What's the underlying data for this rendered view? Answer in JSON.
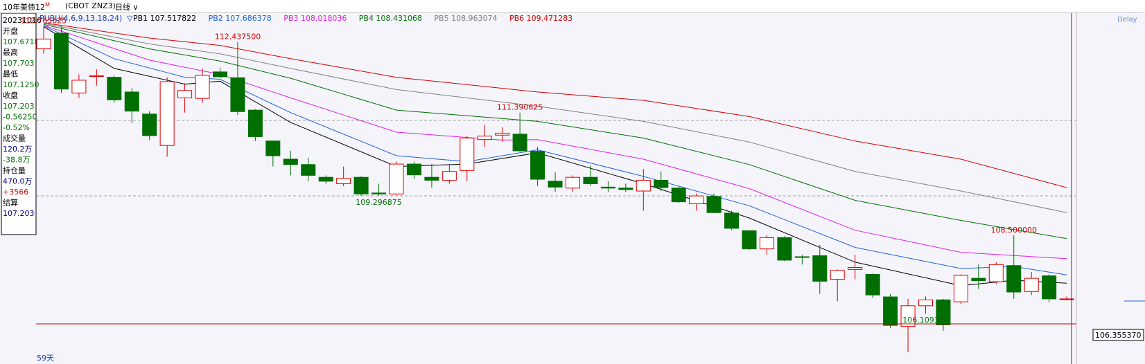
{
  "topbar": {
    "symbol_label": "10年美债12",
    "superscript": "M",
    "code": "(CBOT ZNZ3)",
    "period": "日线",
    "period_arrow": "∨"
  },
  "indicator": {
    "name": "PUBU(4,6,9,13,18,24)",
    "arrow": "▽",
    "items": [
      {
        "label": "PB1",
        "value": "107.517822",
        "color": "#000000"
      },
      {
        "label": "PB2",
        "value": "107.686378",
        "color": "#1f5fd6"
      },
      {
        "label": "PB3",
        "value": "108.018036",
        "color": "#e020e0"
      },
      {
        "label": "PB4",
        "value": "108.431068",
        "color": "#007000"
      },
      {
        "label": "PB5",
        "value": "108.963074",
        "color": "#808080"
      },
      {
        "label": "PB6",
        "value": "109.471283",
        "color": "#d00000"
      }
    ]
  },
  "delay_label": "Delay",
  "info_panel": [
    {
      "text": "20231016",
      "color": "#000000"
    },
    {
      "text": "开盘",
      "color": "#000000"
    },
    {
      "text": "107.6718",
      "color": "#007000"
    },
    {
      "text": "最高",
      "color": "#000000"
    },
    {
      "text": "107.703",
      "color": "#007000"
    },
    {
      "text": "最低",
      "color": "#000000"
    },
    {
      "text": "107.1250",
      "color": "#007000"
    },
    {
      "text": "收盘",
      "color": "#000000"
    },
    {
      "text": "107.203",
      "color": "#007000"
    },
    {
      "text": "-0.56250",
      "color": "#007000"
    },
    {
      "text": "-0.52%",
      "color": "#007000"
    },
    {
      "text": "成交量",
      "color": "#000000"
    },
    {
      "text": "120.2万",
      "color": "#000080"
    },
    {
      "text": "-38.8万",
      "color": "#007000"
    },
    {
      "text": "持仓量",
      "color": "#000000"
    },
    {
      "text": "470.0万",
      "color": "#000080"
    },
    {
      "text": "+3566",
      "color": "#d00000"
    },
    {
      "text": "结算",
      "color": "#000000"
    },
    {
      "text": "107.203",
      "color": "#000080"
    }
  ],
  "bottom_label": "59天",
  "crosshair_price": "106.355370",
  "colors": {
    "up": "#e00000",
    "down": "#006e00",
    "background": "#f4f4fa",
    "crosshair": "#c00000"
  },
  "chart_data": {
    "type": "candlestick",
    "ylim": [
      105.9,
      113.0
    ],
    "grid": "dashed horizontal",
    "annotations": [
      {
        "text": "112.765625",
        "index": 0,
        "at": "high",
        "color": "#d00000"
      },
      {
        "text": "112.437500",
        "index": 11,
        "at": "high",
        "color": "#d00000"
      },
      {
        "text": "109.296875",
        "index": 19,
        "at": "low",
        "color": "#007000"
      },
      {
        "text": "111.390625",
        "index": 27,
        "at": "high",
        "color": "#d00000"
      },
      {
        "text": "106.109375",
        "index": 50,
        "at": "low",
        "color": "#007000"
      },
      {
        "text": "108.500000",
        "index": 55,
        "at": "high",
        "color": "#d00000"
      }
    ],
    "candles": [
      {
        "o": 112.3,
        "h": 112.77,
        "l": 112.2,
        "c": 112.5
      },
      {
        "o": 112.62,
        "h": 112.75,
        "l": 111.4,
        "c": 111.48
      },
      {
        "o": 111.4,
        "h": 111.78,
        "l": 111.3,
        "c": 111.66
      },
      {
        "o": 111.74,
        "h": 111.88,
        "l": 111.55,
        "c": 111.75
      },
      {
        "o": 111.72,
        "h": 111.75,
        "l": 111.2,
        "c": 111.26
      },
      {
        "o": 111.42,
        "h": 111.5,
        "l": 110.78,
        "c": 111.03
      },
      {
        "o": 110.97,
        "h": 111.03,
        "l": 110.44,
        "c": 110.53
      },
      {
        "o": 110.33,
        "h": 111.72,
        "l": 110.1,
        "c": 111.63
      },
      {
        "o": 111.3,
        "h": 111.6,
        "l": 111.0,
        "c": 111.45
      },
      {
        "o": 111.29,
        "h": 111.9,
        "l": 111.2,
        "c": 111.76
      },
      {
        "o": 111.83,
        "h": 111.92,
        "l": 111.7,
        "c": 111.73
      },
      {
        "o": 111.71,
        "h": 112.44,
        "l": 110.95,
        "c": 111.02
      },
      {
        "o": 111.05,
        "h": 111.07,
        "l": 110.42,
        "c": 110.51
      },
      {
        "o": 110.42,
        "h": 110.43,
        "l": 109.9,
        "c": 110.12
      },
      {
        "o": 110.05,
        "h": 110.22,
        "l": 109.72,
        "c": 109.94
      },
      {
        "o": 109.94,
        "h": 110.08,
        "l": 109.6,
        "c": 109.72
      },
      {
        "o": 109.68,
        "h": 109.72,
        "l": 109.55,
        "c": 109.6
      },
      {
        "o": 109.55,
        "h": 109.9,
        "l": 109.5,
        "c": 109.66
      },
      {
        "o": 109.68,
        "h": 109.7,
        "l": 109.3,
        "c": 109.34
      },
      {
        "o": 109.36,
        "h": 109.55,
        "l": 109.3,
        "c": 109.34
      },
      {
        "o": 109.34,
        "h": 110.0,
        "l": 109.32,
        "c": 109.95
      },
      {
        "o": 109.95,
        "h": 110.0,
        "l": 109.65,
        "c": 109.73
      },
      {
        "o": 109.68,
        "h": 109.95,
        "l": 109.47,
        "c": 109.62
      },
      {
        "o": 109.62,
        "h": 109.95,
        "l": 109.55,
        "c": 109.8
      },
      {
        "o": 109.82,
        "h": 110.52,
        "l": 109.6,
        "c": 110.48
      },
      {
        "o": 110.45,
        "h": 110.75,
        "l": 110.3,
        "c": 110.52
      },
      {
        "o": 110.54,
        "h": 110.7,
        "l": 110.4,
        "c": 110.58
      },
      {
        "o": 110.56,
        "h": 111.0,
        "l": 110.2,
        "c": 110.22
      },
      {
        "o": 110.21,
        "h": 110.3,
        "l": 109.5,
        "c": 109.64
      },
      {
        "o": 109.6,
        "h": 109.78,
        "l": 109.38,
        "c": 109.48
      },
      {
        "o": 109.46,
        "h": 109.72,
        "l": 109.38,
        "c": 109.68
      },
      {
        "o": 109.68,
        "h": 109.92,
        "l": 109.5,
        "c": 109.55
      },
      {
        "o": 109.48,
        "h": 109.6,
        "l": 109.38,
        "c": 109.46
      },
      {
        "o": 109.46,
        "h": 109.55,
        "l": 109.38,
        "c": 109.43
      },
      {
        "o": 109.4,
        "h": 109.85,
        "l": 109.0,
        "c": 109.62
      },
      {
        "o": 109.62,
        "h": 109.8,
        "l": 109.4,
        "c": 109.47
      },
      {
        "o": 109.46,
        "h": 109.5,
        "l": 109.16,
        "c": 109.18
      },
      {
        "o": 109.14,
        "h": 109.35,
        "l": 109.0,
        "c": 109.3
      },
      {
        "o": 109.29,
        "h": 109.35,
        "l": 108.95,
        "c": 108.96
      },
      {
        "o": 108.95,
        "h": 109.0,
        "l": 108.6,
        "c": 108.64
      },
      {
        "o": 108.59,
        "h": 108.6,
        "l": 108.2,
        "c": 108.22
      },
      {
        "o": 108.22,
        "h": 108.5,
        "l": 108.1,
        "c": 108.45
      },
      {
        "o": 108.45,
        "h": 108.48,
        "l": 107.97,
        "c": 107.99
      },
      {
        "o": 108.06,
        "h": 108.1,
        "l": 107.9,
        "c": 108.05
      },
      {
        "o": 108.08,
        "h": 108.3,
        "l": 107.3,
        "c": 107.56
      },
      {
        "o": 107.6,
        "h": 107.8,
        "l": 107.15,
        "c": 107.78
      },
      {
        "o": 107.8,
        "h": 108.1,
        "l": 107.6,
        "c": 107.84
      },
      {
        "o": 107.7,
        "h": 107.72,
        "l": 107.22,
        "c": 107.28
      },
      {
        "o": 107.24,
        "h": 107.3,
        "l": 106.6,
        "c": 106.66
      },
      {
        "o": 106.64,
        "h": 107.2,
        "l": 106.11,
        "c": 107.06
      },
      {
        "o": 107.06,
        "h": 107.25,
        "l": 106.9,
        "c": 107.18
      },
      {
        "o": 107.18,
        "h": 107.2,
        "l": 106.55,
        "c": 106.67
      },
      {
        "o": 107.14,
        "h": 107.7,
        "l": 107.1,
        "c": 107.68
      },
      {
        "o": 107.62,
        "h": 107.9,
        "l": 107.4,
        "c": 107.57
      },
      {
        "o": 107.55,
        "h": 107.95,
        "l": 107.5,
        "c": 107.9
      },
      {
        "o": 107.88,
        "h": 108.5,
        "l": 107.2,
        "c": 107.34
      },
      {
        "o": 107.35,
        "h": 107.75,
        "l": 107.28,
        "c": 107.62
      },
      {
        "o": 107.67,
        "h": 107.7,
        "l": 107.13,
        "c": 107.2
      },
      {
        "o": 107.2,
        "h": 107.25,
        "l": 107.17,
        "c": 107.2
      }
    ],
    "ma_lines": [
      {
        "name": "PB6",
        "color": "#d00000",
        "points": [
          [
            0,
            112.83
          ],
          [
            6,
            112.52
          ],
          [
            10,
            112.37
          ],
          [
            14,
            112.1
          ],
          [
            20,
            111.72
          ],
          [
            28,
            111.42
          ],
          [
            34,
            111.25
          ],
          [
            40,
            110.92
          ],
          [
            46,
            110.42
          ],
          [
            52,
            110.05
          ],
          [
            58,
            109.47
          ]
        ]
      },
      {
        "name": "PB5",
        "color": "#808080",
        "points": [
          [
            0,
            112.82
          ],
          [
            6,
            112.4
          ],
          [
            10,
            112.2
          ],
          [
            14,
            111.9
          ],
          [
            20,
            111.47
          ],
          [
            28,
            111.13
          ],
          [
            34,
            110.82
          ],
          [
            40,
            110.4
          ],
          [
            46,
            109.8
          ],
          [
            52,
            109.4
          ],
          [
            58,
            108.96
          ]
        ]
      },
      {
        "name": "PB4",
        "color": "#007000",
        "points": [
          [
            0,
            112.8
          ],
          [
            6,
            112.3
          ],
          [
            10,
            112.05
          ],
          [
            14,
            111.7
          ],
          [
            20,
            111.05
          ],
          [
            28,
            110.82
          ],
          [
            34,
            110.48
          ],
          [
            40,
            109.94
          ],
          [
            46,
            109.21
          ],
          [
            52,
            108.8
          ],
          [
            58,
            108.43
          ]
        ]
      },
      {
        "name": "PB3",
        "color": "#e020e0",
        "points": [
          [
            0,
            112.78
          ],
          [
            6,
            112.07
          ],
          [
            10,
            111.78
          ],
          [
            14,
            111.3
          ],
          [
            20,
            110.6
          ],
          [
            26,
            110.44
          ],
          [
            28,
            110.45
          ],
          [
            34,
            110.05
          ],
          [
            40,
            109.45
          ],
          [
            46,
            108.6
          ],
          [
            52,
            108.15
          ],
          [
            58,
            108.02
          ]
        ]
      },
      {
        "name": "PB2",
        "color": "#1f5fd6",
        "points": [
          [
            0,
            112.77
          ],
          [
            4,
            112.1
          ],
          [
            8,
            111.72
          ],
          [
            10,
            111.68
          ],
          [
            14,
            111.0
          ],
          [
            20,
            110.12
          ],
          [
            24,
            110.0
          ],
          [
            28,
            110.24
          ],
          [
            34,
            109.7
          ],
          [
            40,
            109.1
          ],
          [
            46,
            108.25
          ],
          [
            52,
            107.82
          ],
          [
            55,
            107.86
          ],
          [
            58,
            107.69
          ]
        ]
      },
      {
        "name": "PB1",
        "color": "#000000",
        "points": [
          [
            0,
            112.75
          ],
          [
            4,
            111.9
          ],
          [
            8,
            111.58
          ],
          [
            10,
            111.64
          ],
          [
            14,
            110.8
          ],
          [
            20,
            109.9
          ],
          [
            24,
            109.95
          ],
          [
            28,
            110.18
          ],
          [
            34,
            109.55
          ],
          [
            40,
            108.85
          ],
          [
            46,
            107.95
          ],
          [
            52,
            107.47
          ],
          [
            55,
            107.58
          ],
          [
            58,
            107.52
          ]
        ]
      }
    ]
  }
}
